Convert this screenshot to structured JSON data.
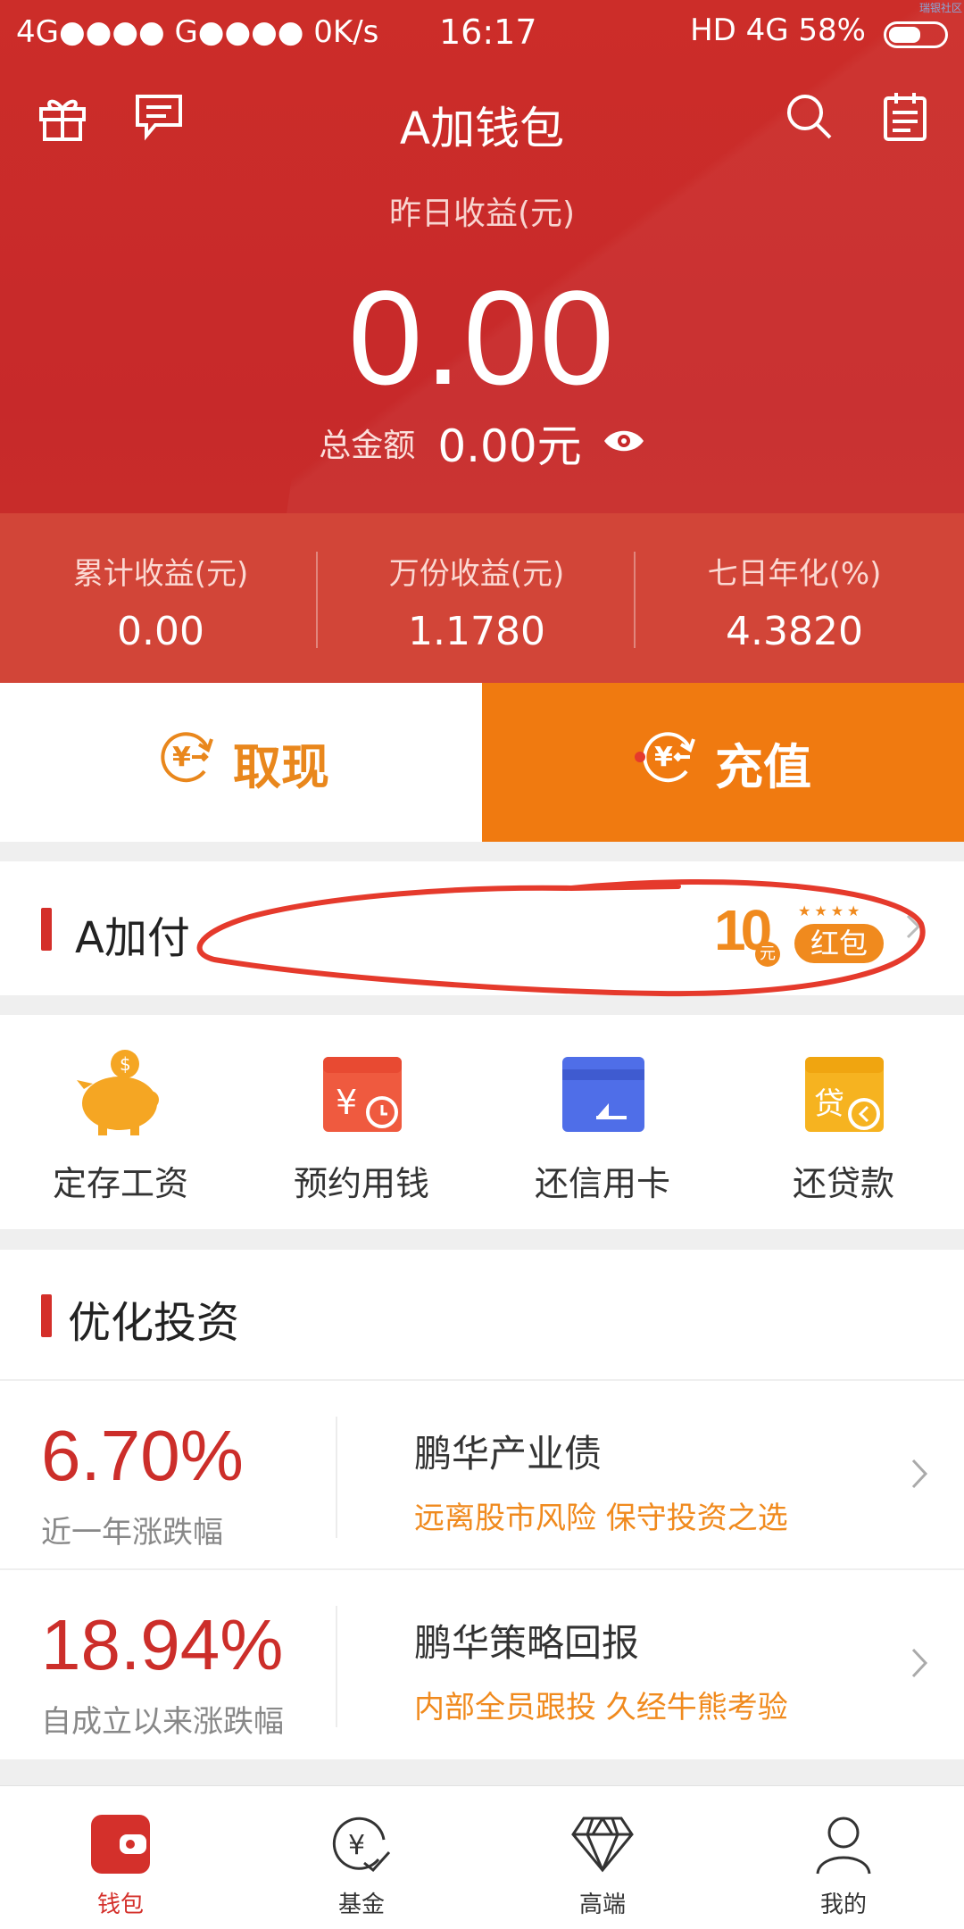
{
  "status_bar": {
    "left": "4G●●●● G●●●● 0K/s",
    "time": "16:17",
    "right": "HD 4G 58%",
    "battery_level": 0.58,
    "corner_text": "瑞银社区"
  },
  "header": {
    "title": "A加钱包",
    "yesterday_label": "昨日收益(元)",
    "yesterday_value": "0.00",
    "total_label": "总金额",
    "total_value": "0.00元"
  },
  "stats": [
    {
      "label": "累计收益(元)",
      "value": "0.00"
    },
    {
      "label": "万份收益(元)",
      "value": "1.1780"
    },
    {
      "label": "七日年化(%)",
      "value": "4.3820"
    }
  ],
  "actions": {
    "withdraw": "取现",
    "recharge": "充值"
  },
  "apay": {
    "title": "A加付",
    "promo_amount": "10",
    "promo_unit": "元",
    "promo_label": "红包"
  },
  "services": [
    {
      "label": "定存工资",
      "icon": "piggy-bank-icon"
    },
    {
      "label": "预约用钱",
      "icon": "calendar-money-icon"
    },
    {
      "label": "还信用卡",
      "icon": "credit-card-icon"
    },
    {
      "label": "还贷款",
      "icon": "loan-icon"
    }
  ],
  "invest": {
    "title": "优化投资",
    "products": [
      {
        "pct": "6.70%",
        "pct_label": "近一年涨跌幅",
        "name": "鹏华产业债",
        "desc": "远离股市风险 保守投资之选"
      },
      {
        "pct": "18.94%",
        "pct_label": "自成立以来涨跌幅",
        "name": "鹏华策略回报",
        "desc": "内部全员跟投  久经牛熊考验"
      }
    ]
  },
  "nav": [
    {
      "label": "钱包",
      "icon": "wallet-icon",
      "active": true
    },
    {
      "label": "基金",
      "icon": "fund-icon",
      "active": false
    },
    {
      "label": "高端",
      "icon": "diamond-icon",
      "active": false
    },
    {
      "label": "我的",
      "icon": "user-icon",
      "active": false
    }
  ],
  "colors": {
    "brand_red": "#cc2d29",
    "orange": "#f07a10",
    "highlight": "#e53a2c"
  }
}
